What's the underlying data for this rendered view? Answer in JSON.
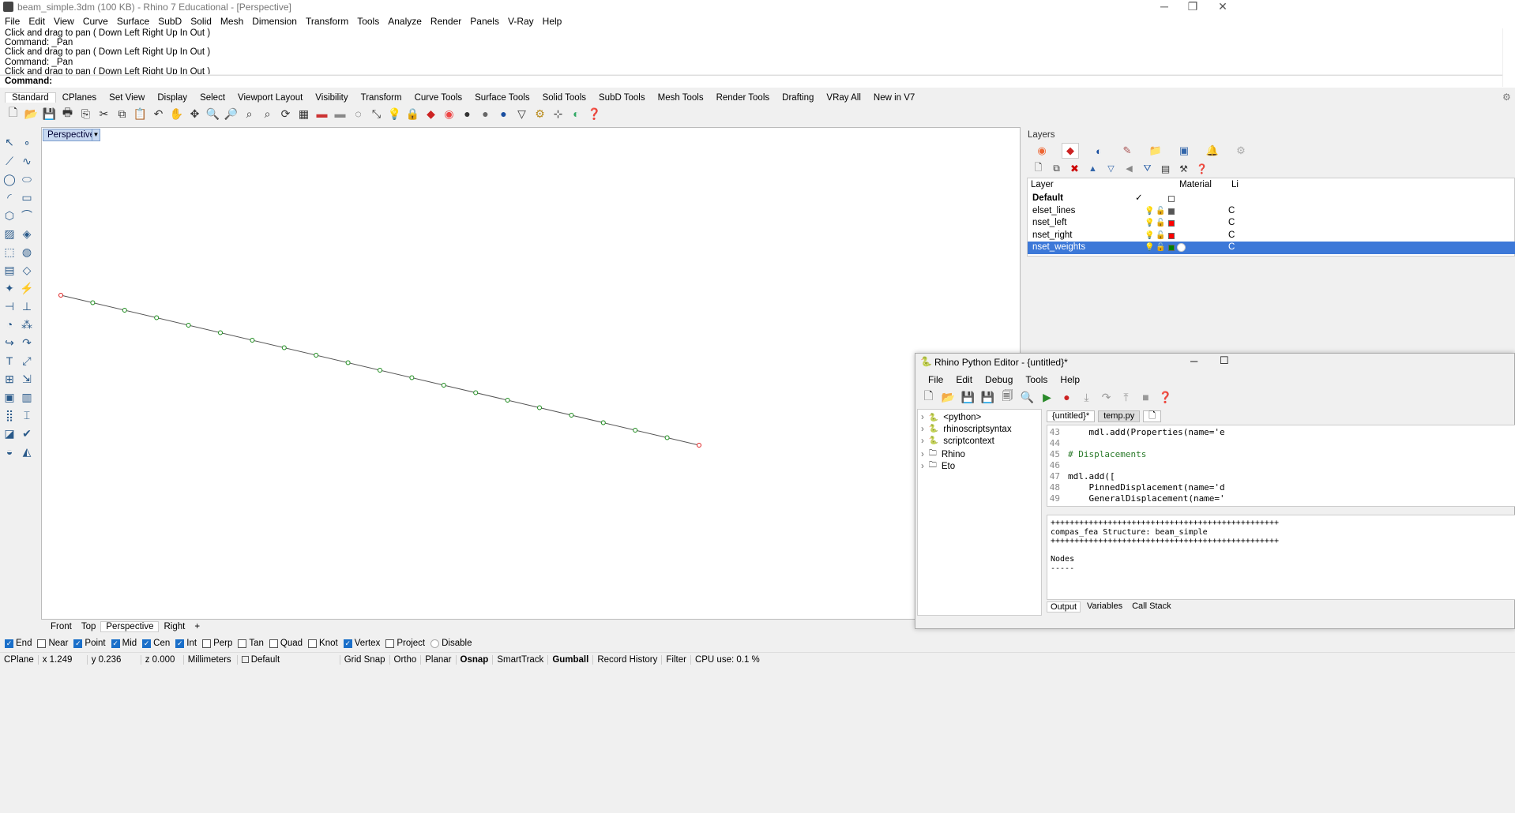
{
  "window": {
    "title": "beam_simple.3dm (100 KB) - Rhino 7 Educational - [Perspective]",
    "min": "─",
    "max": "❐",
    "close": "✕"
  },
  "menu": [
    "File",
    "Edit",
    "View",
    "Curve",
    "Surface",
    "SubD",
    "Solid",
    "Mesh",
    "Dimension",
    "Transform",
    "Tools",
    "Analyze",
    "Render",
    "Panels",
    "V-Ray",
    "Help"
  ],
  "command_history": [
    "Click and drag to pan ( Down  Left  Right  Up  In  Out )",
    "Command: _Pan",
    "Click and drag to pan ( Down  Left  Right  Up  In  Out )",
    "Command: _Pan",
    "Click and drag to pan ( Down  Left  Right  Up  In  Out )"
  ],
  "command_prompt": "Command:",
  "toolbar_tabs": [
    "Standard",
    "CPlanes",
    "Set View",
    "Display",
    "Select",
    "Viewport Layout",
    "Visibility",
    "Transform",
    "Curve Tools",
    "Surface Tools",
    "Solid Tools",
    "SubD Tools",
    "Mesh Tools",
    "Render Tools",
    "Drafting",
    "VRay All",
    "New in V7"
  ],
  "viewport": {
    "label": "Perspective",
    "tabs": [
      "Front",
      "Top",
      "Perspective",
      "Right"
    ],
    "add_tab": "+"
  },
  "osnaps": [
    {
      "label": "End",
      "on": true
    },
    {
      "label": "Near",
      "on": false
    },
    {
      "label": "Point",
      "on": true
    },
    {
      "label": "Mid",
      "on": true
    },
    {
      "label": "Cen",
      "on": true
    },
    {
      "label": "Int",
      "on": true
    },
    {
      "label": "Perp",
      "on": false
    },
    {
      "label": "Tan",
      "on": false
    },
    {
      "label": "Quad",
      "on": false
    },
    {
      "label": "Knot",
      "on": false
    },
    {
      "label": "Vertex",
      "on": true
    },
    {
      "label": "Project",
      "on": false
    },
    {
      "label": "Disable",
      "on": false
    }
  ],
  "status": {
    "cplane": "CPlane",
    "x": "x 1.249",
    "y": "y 0.236",
    "z": "z 0.000",
    "units": "Millimeters",
    "layer": "Default",
    "grid_snap": "Grid Snap",
    "ortho": "Ortho",
    "planar": "Planar",
    "osnap": "Osnap",
    "smarttrack": "SmartTrack",
    "gumball": "Gumball",
    "record_history": "Record History",
    "filter": "Filter",
    "cpu": "CPU use: 0.1 %"
  },
  "layers_panel": {
    "title": "Layers",
    "columns": {
      "layer": "Layer",
      "material": "Material",
      "linetype": "Li"
    },
    "rows": [
      {
        "name": "Default",
        "color": "#ffffff",
        "current": true,
        "bold": true,
        "selected": false,
        "linetype": ""
      },
      {
        "name": "elset_lines",
        "color": "#555555",
        "current": false,
        "bold": false,
        "selected": false,
        "linetype": "C"
      },
      {
        "name": "nset_left",
        "color": "#ff0000",
        "current": false,
        "bold": false,
        "selected": false,
        "linetype": "C"
      },
      {
        "name": "nset_right",
        "color": "#ff0000",
        "current": false,
        "bold": false,
        "selected": false,
        "linetype": "C"
      },
      {
        "name": "nset_weights",
        "color": "#008000",
        "current": false,
        "bold": false,
        "selected": true,
        "linetype": "C"
      }
    ],
    "check": "✓"
  },
  "python_editor": {
    "title": "Rhino Python Editor - {untitled}*",
    "menu": [
      "File",
      "Edit",
      "Debug",
      "Tools",
      "Help"
    ],
    "tree": [
      "<python>",
      "rhinoscriptsyntax",
      "scriptcontext",
      "Rhino",
      "Eto"
    ],
    "tabs": [
      "{untitled}*",
      "temp.py"
    ],
    "code": [
      {
        "no": "43",
        "text": "    mdl.add(Properties(name='e"
      },
      {
        "no": "44",
        "text": ""
      },
      {
        "no": "45",
        "text": "# Displacements"
      },
      {
        "no": "46",
        "text": ""
      },
      {
        "no": "47",
        "text": "mdl.add(["
      },
      {
        "no": "48",
        "text": "    PinnedDisplacement(name='d"
      },
      {
        "no": "49",
        "text": "    GeneralDisplacement(name='"
      }
    ],
    "output": "++++++++++++++++++++++++++++++++++++++++++++++++\ncompas_fea Structure: beam_simple\n++++++++++++++++++++++++++++++++++++++++++++++++\n\nNodes\n-----",
    "output_tabs": [
      "Output",
      "Variables",
      "Call Stack"
    ],
    "min": "─",
    "max": "☐"
  },
  "beam": {
    "start": [
      76,
      373
    ],
    "end": [
      884,
      563
    ],
    "nodes": 21
  }
}
